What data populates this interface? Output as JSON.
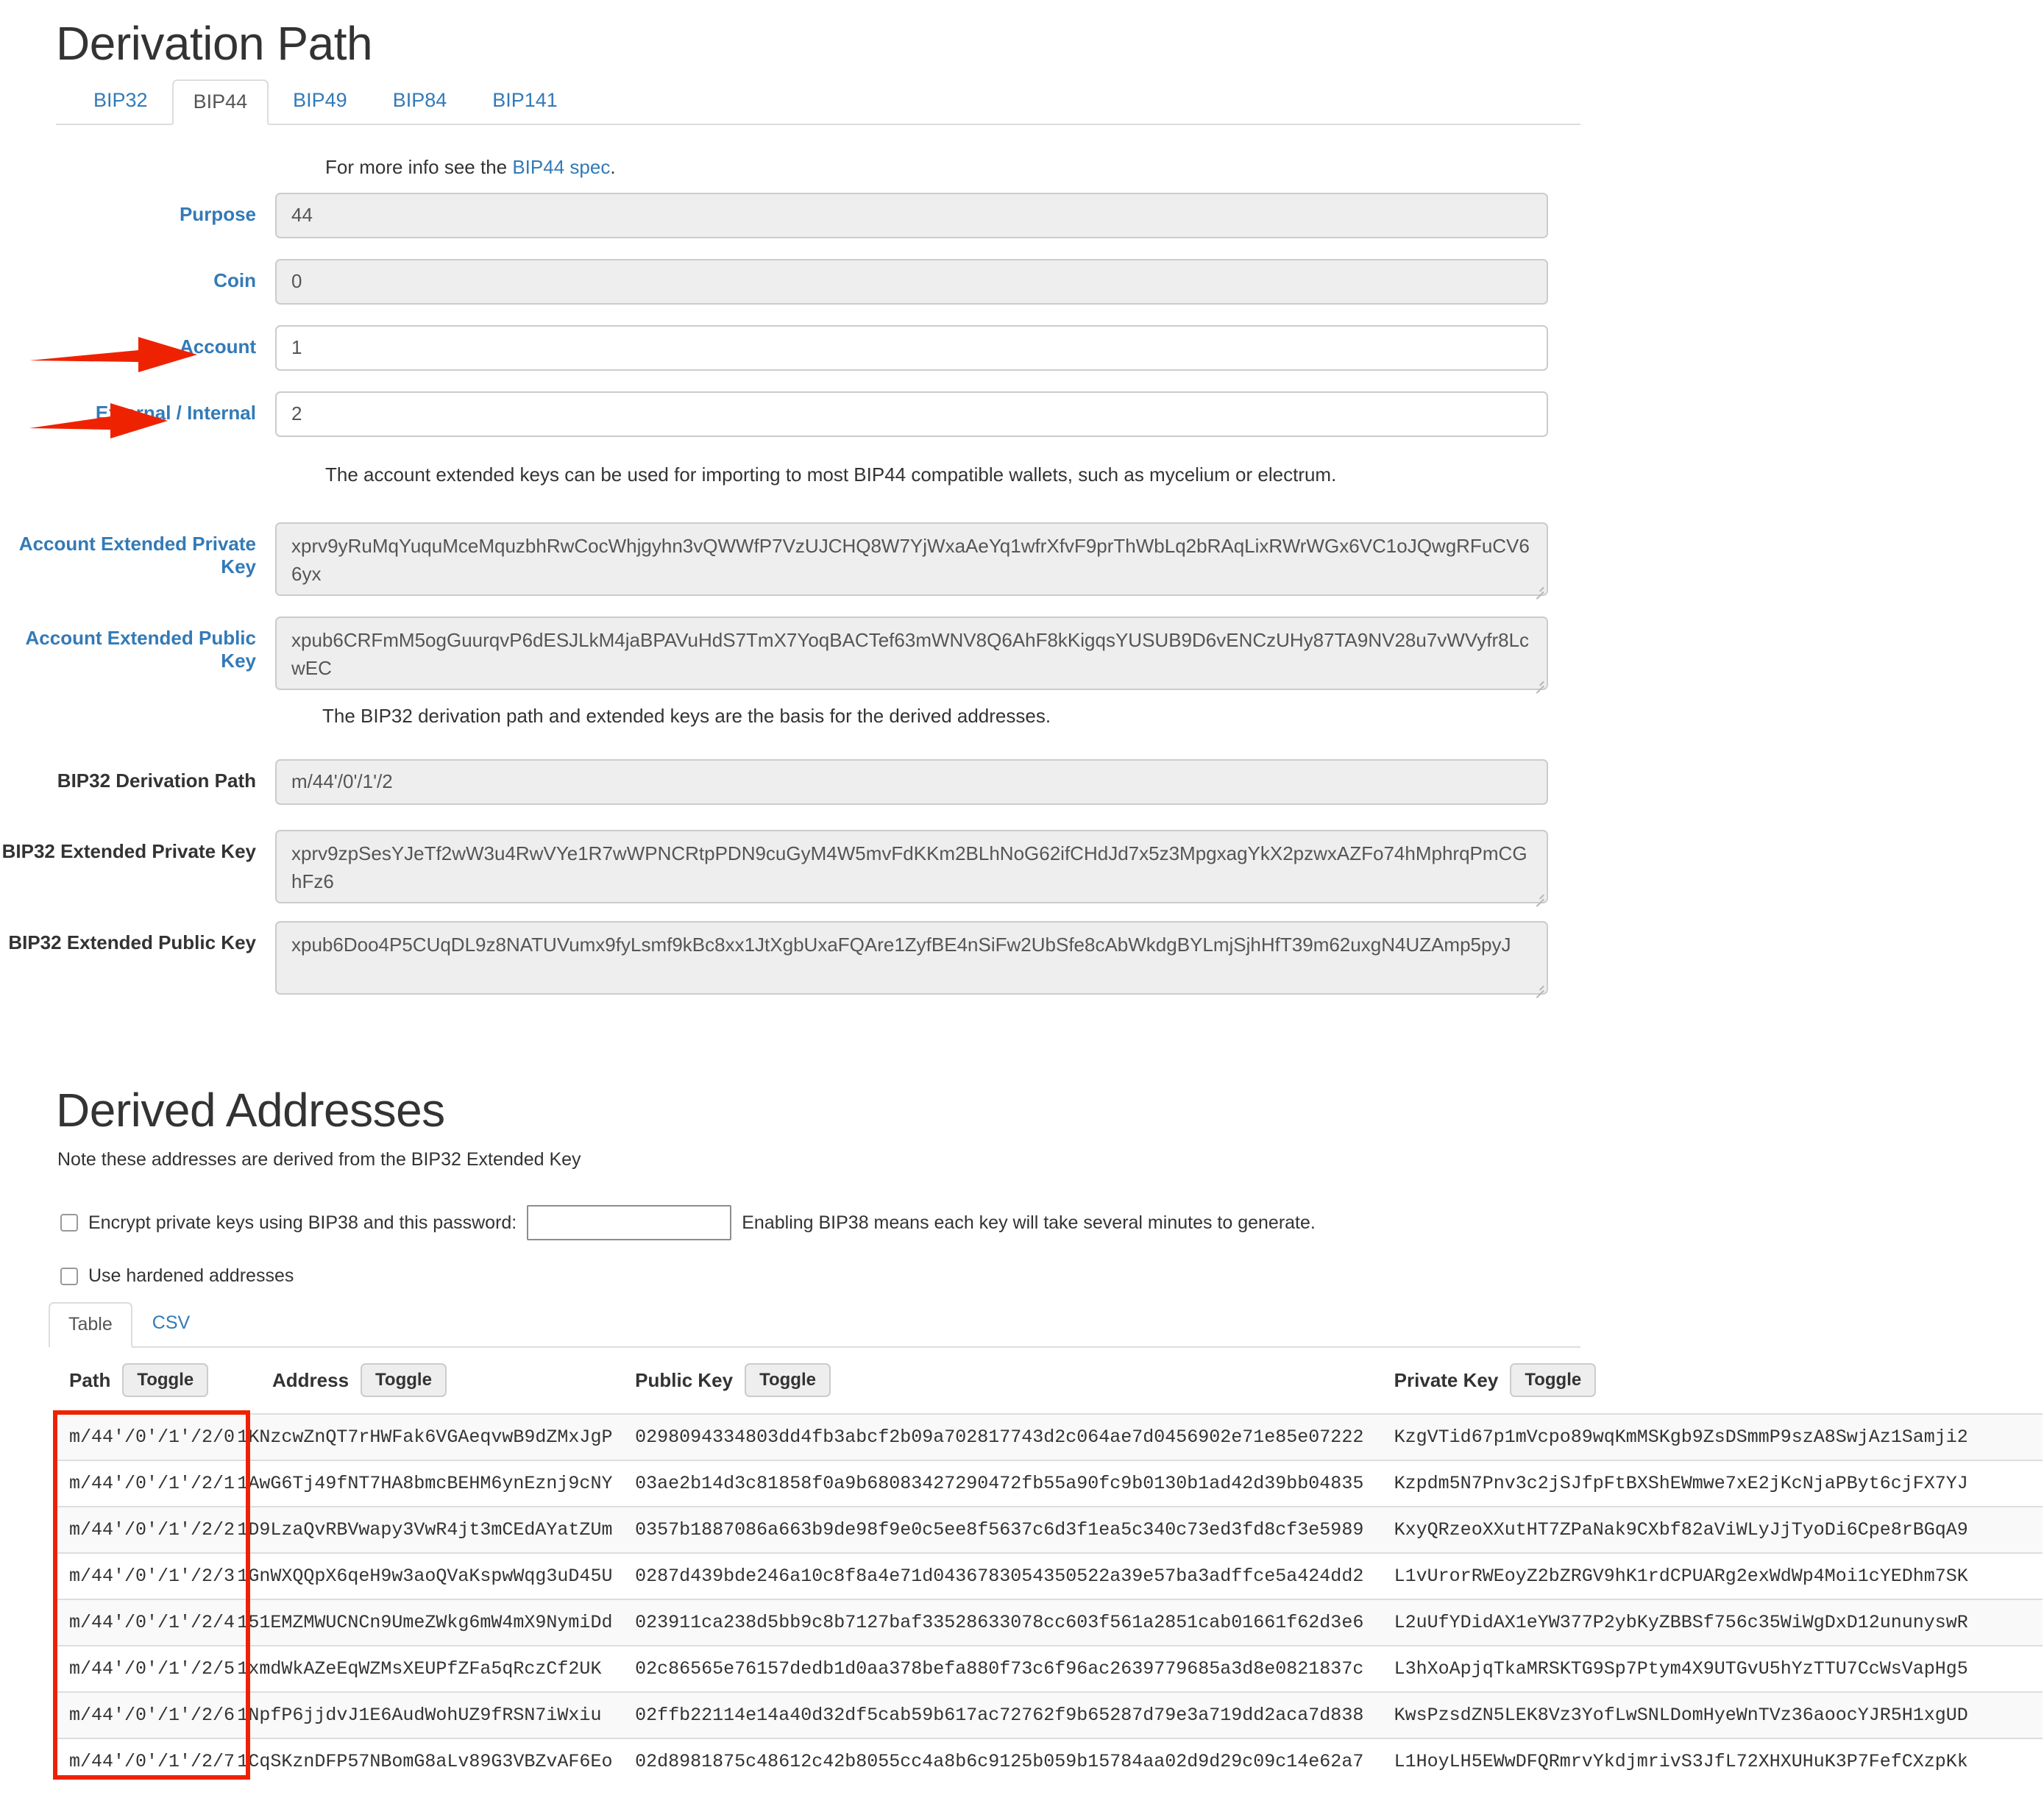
{
  "derivation": {
    "title": "Derivation Path",
    "tabs": [
      {
        "label": "BIP32",
        "active": false
      },
      {
        "label": "BIP44",
        "active": true
      },
      {
        "label": "BIP49",
        "active": false
      },
      {
        "label": "BIP84",
        "active": false
      },
      {
        "label": "BIP141",
        "active": false
      }
    ],
    "info_prefix": "For more info see the ",
    "info_link": "BIP44 spec",
    "info_suffix": ".",
    "fields": {
      "purpose_label": "Purpose",
      "purpose_value": "44",
      "coin_label": "Coin",
      "coin_value": "0",
      "account_label": "Account",
      "account_value": "1",
      "change_label": "External / Internal",
      "change_value": "2"
    },
    "account_note": "The account extended keys can be used for importing to most BIP44 compatible wallets, such as mycelium or electrum.",
    "account_xprv_label": "Account Extended Private Key",
    "account_xprv_value": "xprv9yRuMqYuquMceMquzbhRwCocWhjgyhn3vQWWfP7VzUJCHQ8W7YjWxaAeYq1wfrXfvF9prThWbLq2bRAqLixRWrWGx6VC1oJQwgRFuCV66yx",
    "account_xpub_label": "Account Extended Public Key",
    "account_xpub_value": "xpub6CRFmM5ogGuurqvP6dESJLkM4jaBPAVuHdS7TmX7YoqBACTef63mWNV8Q6AhF8kKigqsYUSUB9D6vENCzUHy87TA9NV28u7vWVyfr8LcwEC",
    "bip32_note": "The BIP32 derivation path and extended keys are the basis for the derived addresses.",
    "bip32_path_label": "BIP32 Derivation Path",
    "bip32_path_value": "m/44'/0'/1'/2",
    "bip32_xprv_label": "BIP32 Extended Private Key",
    "bip32_xprv_value": "xprv9zpSesYJeTf2wW3u4RwVYe1R7wWPNCRtpPDN9cuGyM4W5mvFdKKm2BLhNoG62ifCHdJd7x5z3MpgxagYkX2pzwxAZFo74hMphrqPmCGhFz6",
    "bip32_xpub_label": "BIP32 Extended Public Key",
    "bip32_xpub_value": "xpub6Doo4P5CUqDL9z8NATUVumx9fyLsmf9kBc8xx1JtXgbUxaFQAre1ZyfBE4nSiFw2UbSfe8cAbWkdgBYLmjSjhHfT39m62uxgN4UZAmp5pyJ"
  },
  "derived": {
    "title": "Derived Addresses",
    "note": "Note these addresses are derived from the BIP32 Extended Key",
    "bip38_label": "Encrypt private keys using BIP38 and this password:",
    "bip38_password_value": "",
    "bip38_hint": "Enabling BIP38 means each key will take several minutes to generate.",
    "hardened_label": "Use hardened addresses",
    "subtabs": [
      {
        "label": "Table",
        "active": true
      },
      {
        "label": "CSV",
        "active": false
      }
    ],
    "columns": {
      "path": "Path",
      "address": "Address",
      "public_key": "Public Key",
      "private_key": "Private Key",
      "toggle": "Toggle"
    },
    "rows": [
      {
        "path": "m/44'/0'/1'/2/0",
        "address": "1KNzcwZnQT7rHWFak6VGAeqvwB9dZMxJgP",
        "public_key": "0298094334803dd4fb3abcf2b09a702817743d2c064ae7d0456902e71e85e07222",
        "private_key": "KzgVTid67p1mVcpo89wqKmMSKgb9ZsDSmmP9szA8SwjAz1Samji2"
      },
      {
        "path": "m/44'/0'/1'/2/1",
        "address": "1AwG6Tj49fNT7HA8bmcBEHM6ynEznj9cNY",
        "public_key": "03ae2b14d3c81858f0a9b68083427290472fb55a90fc9b0130b1ad42d39bb04835",
        "private_key": "Kzpdm5N7Pnv3c2jSJfpFtBXShEWmwe7xE2jKcNjaPByt6cjFX7YJ"
      },
      {
        "path": "m/44'/0'/1'/2/2",
        "address": "1D9LzaQvRBVwapy3VwR4jt3mCEdAYatZUm",
        "public_key": "0357b1887086a663b9de98f9e0c5ee8f5637c6d3f1ea5c340c73ed3fd8cf3e5989",
        "private_key": "KxyQRzeoXXutHT7ZPaNak9CXbf82aViWLyJjTyoDi6Cpe8rBGqA9"
      },
      {
        "path": "m/44'/0'/1'/2/3",
        "address": "1GnWXQQpX6qeH9w3aoQVaKspwWqg3uD45U",
        "public_key": "0287d439bde246a10c8f8a4e71d0436783054350522a39e57ba3adffce5a424dd2",
        "private_key": "L1vUrorRWEoyZ2bZRGV9hK1rdCPUARg2exWdWp4Moi1cYEDhm7SK"
      },
      {
        "path": "m/44'/0'/1'/2/4",
        "address": "151EMZMWUCNCn9UmeZWkg6mW4mX9NymiDd",
        "public_key": "023911ca238d5bb9c8b7127baf33528633078cc603f561a2851cab01661f62d3e6",
        "private_key": "L2uUfYDidAX1eYW377P2ybKyZBBSf756c35WiWgDxD12ununyswR"
      },
      {
        "path": "m/44'/0'/1'/2/5",
        "address": "1xmdWkAZeEqWZMsXEUPfZFa5qRczCf2UK",
        "public_key": "02c86565e76157dedb1d0aa378befa880f73c6f96ac2639779685a3d8e0821837c",
        "private_key": "L3hXoApjqTkaMRSKTG9Sp7Ptym4X9UTGvU5hYzTTU7CcWsVapHg5"
      },
      {
        "path": "m/44'/0'/1'/2/6",
        "address": "1NpfP6jjdvJ1E6AudWohUZ9fRSN7iWxiu",
        "public_key": "02ffb22114e14a40d32df5cab59b617ac72762f9b65287d79e3a719dd2aca7d838",
        "private_key": "KwsPzsdZN5LEK8Vz3YofLwSNLDomHyeWnTVz36aoocYJR5H1xgUD"
      },
      {
        "path": "m/44'/0'/1'/2/7",
        "address": "1CqSKznDFP57NBomG8aLv89G3VBZvAF6Eo",
        "public_key": "02d8981875c48612c42b8055cc4a8b6c9125b059b15784aa02d9d29c09c14e62a7",
        "private_key": "L1HoyLH5EWwDFQRmrvYkdjmrivS3JfL72XHXUHuK3P7FefCXzpKk"
      }
    ]
  },
  "annotations": {
    "arrow_color": "#ee2200",
    "highlight_color": "#ee2200",
    "arrow_account_target": "Account",
    "arrow_change_target": "External / Internal",
    "highlight_target": "Path column"
  },
  "colors": {
    "link": "#337ab7",
    "field_border": "#cccccc",
    "field_bg": "#eeeeee",
    "text": "#333333"
  }
}
